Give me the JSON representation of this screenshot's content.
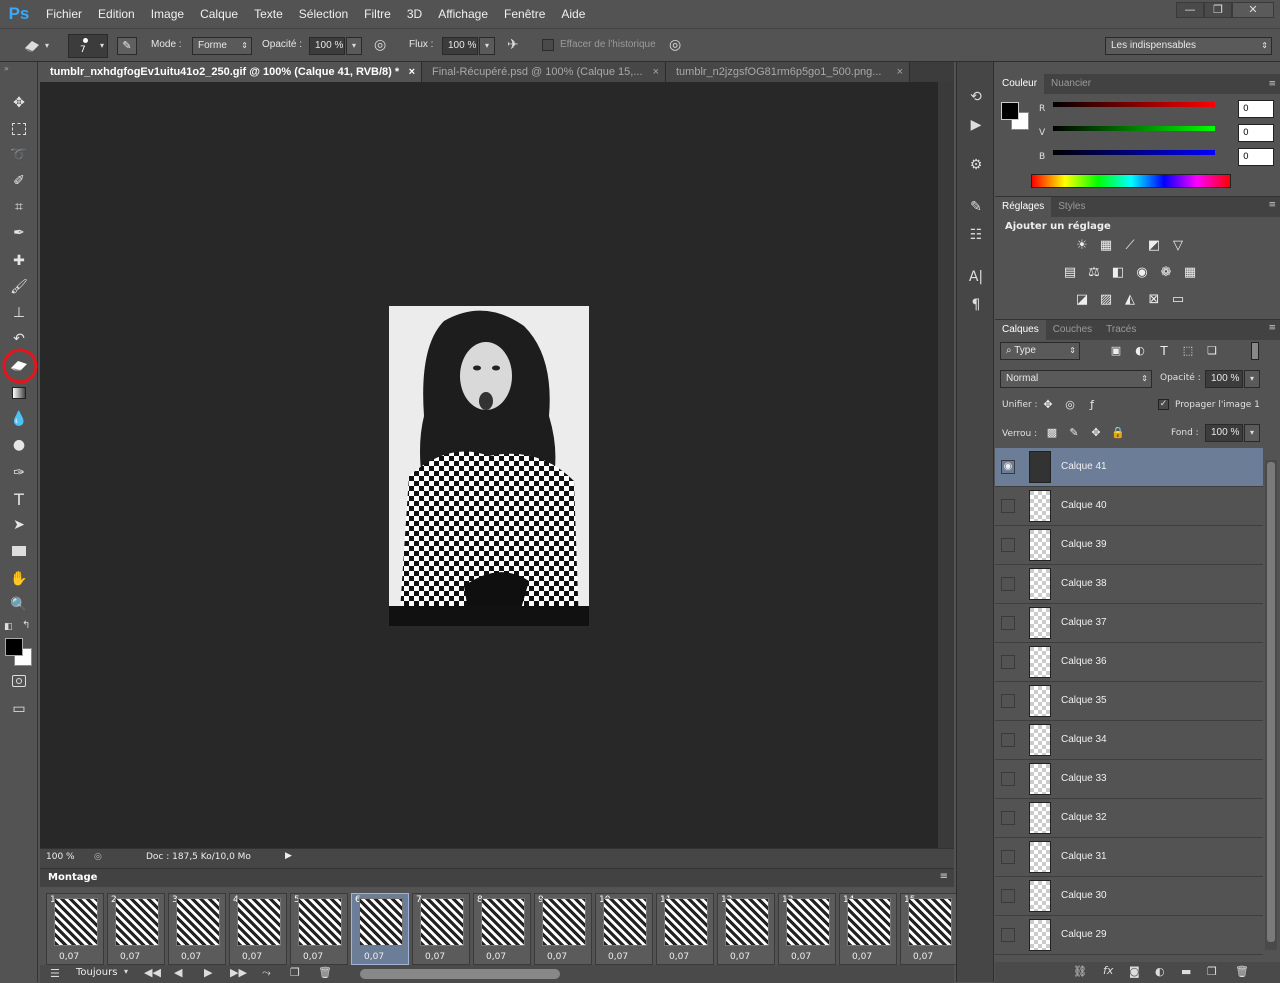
{
  "app_logo": "Ps",
  "menu": [
    "Fichier",
    "Edition",
    "Image",
    "Calque",
    "Texte",
    "Sélection",
    "Filtre",
    "3D",
    "Affichage",
    "Fenêtre",
    "Aide"
  ],
  "window_controls": {
    "minimize": "—",
    "maximize": "❐",
    "close": "✕"
  },
  "options": {
    "brush_size": "7",
    "mode_label": "Mode :",
    "mode_value": "Forme",
    "opacity_label": "Opacité :",
    "opacity_value": "100 %",
    "flow_label": "Flux :",
    "flow_value": "100 %",
    "history_label": "Effacer de l'historique",
    "workspace": "Les indispensables"
  },
  "doc_tabs": [
    {
      "label": "tumblr_nxhdgfogEv1uitu41o2_250.gif @ 100% (Calque 41, RVB/8) *",
      "close": "×"
    },
    {
      "label": "Final-Récupéré.psd @ 100% (Calque 15,...",
      "close": "×"
    },
    {
      "label": "tumblr_n2jzgsfOG81rm6p5go1_500.png...",
      "close": "×"
    }
  ],
  "status": {
    "zoom": "100 %",
    "doc": "Doc : 187,5 Ko/10,0 Mo"
  },
  "timeline": {
    "title": "Montage",
    "frames": [
      {
        "n": "1",
        "d": "0,07"
      },
      {
        "n": "2",
        "d": "0,07"
      },
      {
        "n": "3",
        "d": "0,07"
      },
      {
        "n": "4",
        "d": "0,07"
      },
      {
        "n": "5",
        "d": "0,07"
      },
      {
        "n": "6",
        "d": "0,07"
      },
      {
        "n": "7",
        "d": "0,07"
      },
      {
        "n": "8",
        "d": "0,07"
      },
      {
        "n": "9",
        "d": "0,07"
      },
      {
        "n": "10",
        "d": "0,07"
      },
      {
        "n": "11",
        "d": "0,07"
      },
      {
        "n": "12",
        "d": "0,07"
      },
      {
        "n": "13",
        "d": "0,07"
      },
      {
        "n": "14",
        "d": "0,07"
      },
      {
        "n": "15",
        "d": "0,07"
      }
    ],
    "selected_frame": "6",
    "loop": "Toujours"
  },
  "color_panel": {
    "tabs": [
      "Couleur",
      "Nuancier"
    ],
    "labels": [
      "R",
      "V",
      "B"
    ],
    "values": [
      "0",
      "0",
      "0"
    ]
  },
  "adjust_panel": {
    "tabs": [
      "Réglages",
      "Styles"
    ],
    "title": "Ajouter un réglage"
  },
  "layers_panel": {
    "tabs": [
      "Calques",
      "Couches",
      "Tracés"
    ],
    "filter": "Type",
    "blend": "Normal",
    "opacity_label": "Opacité :",
    "opacity": "100 %",
    "unify_label": "Unifier :",
    "propagate": "Propager l'image 1",
    "lock_label": "Verrou :",
    "fill_label": "Fond :",
    "fill": "100 %",
    "layers": [
      "Calque 41",
      "Calque 40",
      "Calque 39",
      "Calque 38",
      "Calque 37",
      "Calque 36",
      "Calque 35",
      "Calque 34",
      "Calque 33",
      "Calque 32",
      "Calque 31",
      "Calque 30",
      "Calque 29"
    ]
  },
  "colors": {
    "annotation_red": "#e8141b",
    "selected_layer": "#6c7d97",
    "canvas_bg": "#282828"
  }
}
